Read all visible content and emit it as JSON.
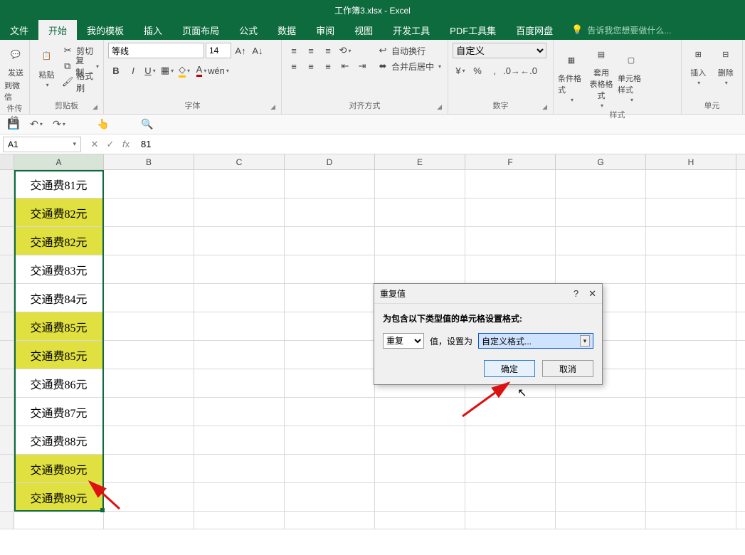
{
  "title": "工作簿3.xlsx - Excel",
  "tabs": {
    "file": "文件",
    "home": "开始",
    "mytpl": "我的模板",
    "insert": "插入",
    "layout": "页面布局",
    "formula": "公式",
    "data": "数据",
    "review": "审阅",
    "view": "视图",
    "dev": "开发工具",
    "pdf": "PDF工具集",
    "baidu": "百度网盘"
  },
  "tellme": "告诉我您想要做什么...",
  "ribbon": {
    "g1": {
      "send": "发送",
      "wechat": "到微信",
      "label": "件传输"
    },
    "clipboard": {
      "paste": "粘贴",
      "cut": "剪切",
      "copy": "复制",
      "format": "格式刷",
      "label": "剪贴板"
    },
    "font": {
      "name": "等线",
      "size": "14",
      "label": "字体"
    },
    "align": {
      "wrap": "自动换行",
      "merge": "合并后居中",
      "label": "对齐方式"
    },
    "number": {
      "format": "自定义",
      "label": "数字"
    },
    "styles": {
      "cond": "条件格式",
      "table": "套用\n表格格式",
      "cell": "单元格样式",
      "label": "样式"
    },
    "cells": {
      "insert": "插入",
      "delete": "删除",
      "label": "单元"
    }
  },
  "namebox": "A1",
  "fx_value": "81",
  "columns": [
    "A",
    "B",
    "C",
    "D",
    "E",
    "F",
    "G",
    "H"
  ],
  "cells": {
    "a1": "交通费81元",
    "a2": "交通费82元",
    "a3": "交通费82元",
    "a4": "交通费83元",
    "a5": "交通费84元",
    "a6": "交通费85元",
    "a7": "交通费85元",
    "a8": "交通费86元",
    "a9": "交通费87元",
    "a10": "交通费88元",
    "a11": "交通费89元",
    "a12": "交通费89元"
  },
  "dialog": {
    "title": "重复值",
    "help": "?",
    "close": "✕",
    "desc": "为包含以下类型值的单元格设置格式:",
    "type_value": "重复",
    "set_label": "值，设置为",
    "format_value": "自定义格式...",
    "ok": "确定",
    "cancel": "取消"
  }
}
